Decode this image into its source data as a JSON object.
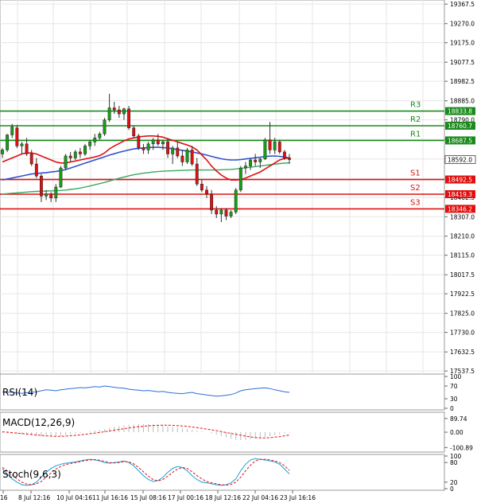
{
  "chart_data": [
    {
      "type": "candlestick",
      "title": "",
      "yaxis_ticks": [
        "19367.5",
        "19270.0",
        "19175.0",
        "19077.5",
        "18982.5",
        "18885.0",
        "18790.0",
        "18692.5",
        "18595.0",
        "18497.5",
        "18402.5",
        "18307.0",
        "18210.0",
        "18115.0",
        "18017.5",
        "17922.5",
        "17825.0",
        "17730.0",
        "17632.5",
        "17537.5"
      ],
      "ylim": [
        17530,
        19380
      ],
      "grid": true,
      "xaxis_ticks": [
        "16",
        "8 Jul 12:16",
        "10 Jul 04:16",
        "11 Jul 16:16",
        "15 Jul 08:16",
        "17 Jul 00:16",
        "18 Jul 12:16",
        "22 Jul 04:16",
        "23 Jul 16:16"
      ],
      "candles": [
        {
          "o": 18620,
          "h": 18650,
          "l": 18600,
          "c": 18640
        },
        {
          "o": 18640,
          "h": 18720,
          "l": 18630,
          "c": 18715
        },
        {
          "o": 18715,
          "h": 18770,
          "l": 18700,
          "c": 18755
        },
        {
          "o": 18750,
          "h": 18765,
          "l": 18650,
          "c": 18660
        },
        {
          "o": 18660,
          "h": 18680,
          "l": 18620,
          "c": 18670
        },
        {
          "o": 18670,
          "h": 18700,
          "l": 18610,
          "c": 18620
        },
        {
          "o": 18620,
          "h": 18640,
          "l": 18560,
          "c": 18570
        },
        {
          "o": 18570,
          "h": 18600,
          "l": 18500,
          "c": 18510
        },
        {
          "o": 18510,
          "h": 18520,
          "l": 18380,
          "c": 18410
        },
        {
          "o": 18410,
          "h": 18440,
          "l": 18390,
          "c": 18420
        },
        {
          "o": 18420,
          "h": 18430,
          "l": 18380,
          "c": 18400
        },
        {
          "o": 18400,
          "h": 18470,
          "l": 18380,
          "c": 18455
        },
        {
          "o": 18455,
          "h": 18560,
          "l": 18450,
          "c": 18550
        },
        {
          "o": 18550,
          "h": 18620,
          "l": 18540,
          "c": 18610
        },
        {
          "o": 18610,
          "h": 18630,
          "l": 18580,
          "c": 18600
        },
        {
          "o": 18600,
          "h": 18640,
          "l": 18590,
          "c": 18630
        },
        {
          "o": 18630,
          "h": 18650,
          "l": 18600,
          "c": 18620
        },
        {
          "o": 18620,
          "h": 18670,
          "l": 18610,
          "c": 18660
        },
        {
          "o": 18660,
          "h": 18690,
          "l": 18640,
          "c": 18680
        },
        {
          "o": 18680,
          "h": 18720,
          "l": 18660,
          "c": 18700
        },
        {
          "o": 18700,
          "h": 18730,
          "l": 18690,
          "c": 18720
        },
        {
          "o": 18720,
          "h": 18800,
          "l": 18710,
          "c": 18790
        },
        {
          "o": 18790,
          "h": 18920,
          "l": 18780,
          "c": 18850
        },
        {
          "o": 18850,
          "h": 18880,
          "l": 18820,
          "c": 18840
        },
        {
          "o": 18840,
          "h": 18860,
          "l": 18800,
          "c": 18820
        },
        {
          "o": 18820,
          "h": 18850,
          "l": 18790,
          "c": 18845
        },
        {
          "o": 18845,
          "h": 18860,
          "l": 18740,
          "c": 18750
        },
        {
          "o": 18750,
          "h": 18760,
          "l": 18700,
          "c": 18710
        },
        {
          "o": 18710,
          "h": 18720,
          "l": 18640,
          "c": 18650
        },
        {
          "o": 18650,
          "h": 18670,
          "l": 18620,
          "c": 18640
        },
        {
          "o": 18640,
          "h": 18680,
          "l": 18620,
          "c": 18670
        },
        {
          "o": 18670,
          "h": 18700,
          "l": 18640,
          "c": 18690
        },
        {
          "o": 18690,
          "h": 18720,
          "l": 18660,
          "c": 18670
        },
        {
          "o": 18670,
          "h": 18690,
          "l": 18640,
          "c": 18680
        },
        {
          "o": 18680,
          "h": 18700,
          "l": 18600,
          "c": 18620
        },
        {
          "o": 18620,
          "h": 18660,
          "l": 18570,
          "c": 18650
        },
        {
          "o": 18650,
          "h": 18680,
          "l": 18600,
          "c": 18610
        },
        {
          "o": 18610,
          "h": 18640,
          "l": 18560,
          "c": 18580
        },
        {
          "o": 18580,
          "h": 18650,
          "l": 18570,
          "c": 18640
        },
        {
          "o": 18640,
          "h": 18660,
          "l": 18560,
          "c": 18570
        },
        {
          "o": 18570,
          "h": 18600,
          "l": 18460,
          "c": 18470
        },
        {
          "o": 18470,
          "h": 18490,
          "l": 18430,
          "c": 18440
        },
        {
          "o": 18440,
          "h": 18460,
          "l": 18400,
          "c": 18420
        },
        {
          "o": 18420,
          "h": 18440,
          "l": 18320,
          "c": 18340
        },
        {
          "o": 18340,
          "h": 18360,
          "l": 18300,
          "c": 18320
        },
        {
          "o": 18320,
          "h": 18350,
          "l": 18280,
          "c": 18340
        },
        {
          "o": 18340,
          "h": 18350,
          "l": 18290,
          "c": 18310
        },
        {
          "o": 18310,
          "h": 18340,
          "l": 18300,
          "c": 18330
        },
        {
          "o": 18330,
          "h": 18450,
          "l": 18320,
          "c": 18440
        },
        {
          "o": 18440,
          "h": 18560,
          "l": 18430,
          "c": 18550
        },
        {
          "o": 18550,
          "h": 18580,
          "l": 18520,
          "c": 18560
        },
        {
          "o": 18560,
          "h": 18600,
          "l": 18540,
          "c": 18590
        },
        {
          "o": 18590,
          "h": 18620,
          "l": 18560,
          "c": 18580
        },
        {
          "o": 18580,
          "h": 18600,
          "l": 18550,
          "c": 18595
        },
        {
          "o": 18595,
          "h": 18700,
          "l": 18590,
          "c": 18690
        },
        {
          "o": 18690,
          "h": 18780,
          "l": 18620,
          "c": 18640
        },
        {
          "o": 18640,
          "h": 18700,
          "l": 18620,
          "c": 18680
        },
        {
          "o": 18680,
          "h": 18690,
          "l": 18620,
          "c": 18630
        },
        {
          "o": 18630,
          "h": 18640,
          "l": 18590,
          "c": 18600
        },
        {
          "o": 18600,
          "h": 18620,
          "l": 18570,
          "c": 18592
        }
      ],
      "levels": [
        {
          "name": "R3",
          "value": 18833.8,
          "label": "18833.8",
          "color": "#1a8a1a"
        },
        {
          "name": "R2",
          "value": 18760.7,
          "label": "18760.7",
          "color": "#1a8a1a"
        },
        {
          "name": "R1",
          "value": 18687.5,
          "label": "18687.5",
          "color": "#1a8a1a"
        },
        {
          "name": "S1",
          "value": 18492.5,
          "label": "18492.5",
          "color": "#e01010"
        },
        {
          "name": "S2",
          "value": 18419.3,
          "label": "18419.3",
          "color": "#e01010"
        },
        {
          "name": "S3",
          "value": 18346.2,
          "label": "18346.2",
          "color": "#e01010"
        }
      ],
      "current_price": {
        "value": 18592.0,
        "label": "18592.0"
      },
      "up_color": "#16a016",
      "down_color": "#e01010",
      "ma_red": [
        18580,
        18590,
        18600,
        18610,
        18620,
        18625,
        18625,
        18620,
        18610,
        18600,
        18590,
        18580,
        18575,
        18575,
        18580,
        18585,
        18590,
        18595,
        18600,
        18605,
        18612,
        18625,
        18645,
        18660,
        18672,
        18685,
        18695,
        18700,
        18705,
        18708,
        18710,
        18710,
        18708,
        18704,
        18695,
        18688,
        18680,
        18672,
        18665,
        18655,
        18640,
        18615,
        18590,
        18560,
        18535,
        18515,
        18500,
        18490,
        18490,
        18492,
        18500,
        18510,
        18520,
        18530,
        18545,
        18560,
        18575,
        18590,
        18598,
        18600
      ],
      "ma_blue": [
        18490,
        18495,
        18500,
        18505,
        18510,
        18515,
        18520,
        18522,
        18525,
        18527,
        18530,
        18533,
        18537,
        18542,
        18550,
        18558,
        18566,
        18574,
        18582,
        18590,
        18598,
        18606,
        18614,
        18621,
        18628,
        18634,
        18640,
        18645,
        18648,
        18650,
        18652,
        18653,
        18653,
        18652,
        18650,
        18646,
        18642,
        18638,
        18634,
        18630,
        18625,
        18620,
        18614,
        18608,
        18602,
        18596,
        18592,
        18590,
        18590,
        18592,
        18595,
        18598,
        18601,
        18604,
        18607,
        18609,
        18610,
        18608,
        18605,
        18600
      ],
      "ma_green": [
        18420,
        18422,
        18424,
        18426,
        18428,
        18430,
        18432,
        18433,
        18434,
        18435,
        18436,
        18437,
        18438,
        18440,
        18443,
        18446,
        18450,
        18455,
        18460,
        18466,
        18472,
        18478,
        18485,
        18492,
        18499,
        18505,
        18511,
        18516,
        18520,
        18524,
        18527,
        18530,
        18532,
        18534,
        18535,
        18536,
        18537,
        18538,
        18539,
        18540,
        18540,
        18540,
        18540,
        18540,
        18540,
        18541,
        18542,
        18543,
        18545,
        18548,
        18551,
        18554,
        18557,
        18560,
        18563,
        18566,
        18569,
        18572,
        18574,
        18576
      ]
    },
    {
      "type": "line",
      "title": "RSI(14)",
      "yaxis_ticks": [
        "100",
        "70",
        "30",
        "0"
      ],
      "ylim": [
        0,
        100
      ],
      "color": "#2a6fd6",
      "values": [
        52,
        50,
        51,
        48,
        47,
        49,
        50,
        52,
        55,
        58,
        57,
        55,
        58,
        60,
        62,
        63,
        65,
        64,
        66,
        68,
        67,
        70,
        68,
        66,
        64,
        63,
        60,
        58,
        57,
        55,
        56,
        54,
        52,
        53,
        50,
        48,
        47,
        46,
        48,
        50,
        46,
        44,
        42,
        40,
        38,
        39,
        41,
        43,
        48,
        55,
        58,
        60,
        62,
        63,
        64,
        62,
        58,
        55,
        52,
        50
      ]
    },
    {
      "type": "bar",
      "title": "MACD(12,26,9)",
      "yaxis_ticks": [
        "89.74",
        "0.00",
        "-100.89"
      ],
      "ylim": [
        -120,
        115
      ],
      "bar_color": "#bbbbbb",
      "signal_color": "#e01010",
      "bars": [
        -5,
        -8,
        -10,
        -12,
        -15,
        -18,
        -20,
        -25,
        -28,
        -30,
        -30,
        -28,
        -25,
        -20,
        -15,
        -10,
        -5,
        0,
        5,
        10,
        15,
        20,
        28,
        35,
        40,
        45,
        48,
        50,
        52,
        53,
        52,
        50,
        48,
        45,
        40,
        35,
        30,
        25,
        20,
        15,
        10,
        5,
        0,
        -8,
        -16,
        -25,
        -34,
        -42,
        -50,
        -52,
        -50,
        -46,
        -42,
        -38,
        -32,
        -26,
        -20,
        -14,
        -8,
        -3
      ],
      "signal": [
        2,
        0,
        -3,
        -6,
        -9,
        -12,
        -15,
        -18,
        -21,
        -24,
        -26,
        -27,
        -27,
        -26,
        -24,
        -21,
        -18,
        -14,
        -10,
        -6,
        -2,
        3,
        8,
        13,
        18,
        23,
        28,
        32,
        36,
        39,
        42,
        44,
        45,
        46,
        46,
        45,
        43,
        41,
        38,
        34,
        30,
        25,
        20,
        15,
        10,
        4,
        -2,
        -8,
        -14,
        -20,
        -26,
        -31,
        -35,
        -38,
        -38,
        -36,
        -33,
        -29,
        -24,
        -18
      ]
    },
    {
      "type": "line",
      "title": "Stoch(9,6,3)",
      "yaxis_ticks": [
        "100",
        "80",
        "20",
        "0"
      ],
      "ylim": [
        0,
        100
      ],
      "colors": [
        "#1aa0d8",
        "#e01010"
      ],
      "k": [
        60,
        45,
        30,
        20,
        12,
        10,
        12,
        20,
        35,
        50,
        62,
        70,
        75,
        78,
        80,
        82,
        85,
        88,
        90,
        88,
        85,
        80,
        78,
        80,
        82,
        85,
        80,
        70,
        55,
        40,
        28,
        22,
        25,
        35,
        50,
        62,
        68,
        65,
        55,
        40,
        28,
        20,
        18,
        15,
        12,
        10,
        12,
        18,
        30,
        55,
        75,
        88,
        92,
        90,
        88,
        85,
        82,
        75,
        60,
        45
      ],
      "d": [
        65,
        55,
        42,
        30,
        20,
        14,
        12,
        15,
        22,
        35,
        48,
        60,
        68,
        74,
        77,
        80,
        83,
        86,
        88,
        89,
        87,
        84,
        80,
        79,
        80,
        83,
        82,
        76,
        65,
        52,
        38,
        28,
        24,
        28,
        38,
        50,
        60,
        65,
        62,
        52,
        40,
        30,
        22,
        18,
        15,
        12,
        11,
        13,
        20,
        35,
        55,
        72,
        85,
        90,
        90,
        88,
        85,
        80,
        70,
        56
      ]
    }
  ]
}
